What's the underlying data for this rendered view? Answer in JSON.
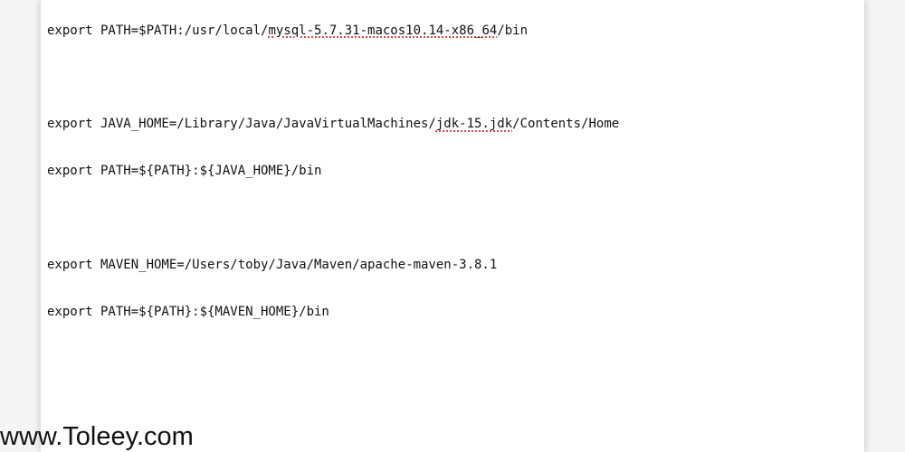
{
  "editor": {
    "lines": [
      {
        "pre": "export PATH=$PATH:/usr/local/",
        "err": "mysql-5.7.31-macos10.14-x86_64",
        "post": "/bin"
      },
      {
        "text": ""
      },
      {
        "pre": "export JAVA_HOME=/Library/Java/JavaVirtualMachines/",
        "err": "jdk-15.jdk",
        "post": "/Contents/Home"
      },
      {
        "text": "export PATH=${PATH}:${JAVA_HOME}/bin"
      },
      {
        "text": ""
      },
      {
        "text": "export MAVEN_HOME=/Users/toby/Java/Maven/apache-maven-3.8.1"
      },
      {
        "text": "export PATH=${PATH}:${MAVEN_HOME}/bin"
      }
    ],
    "spellcheck_underline_color": "#e0474b",
    "text_color": "#111111",
    "background_color": "#ffffff"
  },
  "watermark": {
    "text": "www.Toleey.com"
  }
}
